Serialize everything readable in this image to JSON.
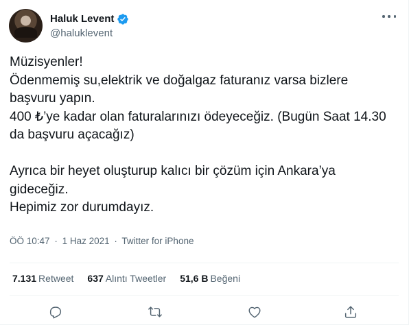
{
  "author": {
    "name": "Haluk Levent",
    "handle": "@haluklevent",
    "verified": true
  },
  "tweet": {
    "text": "Müzisyenler!\nÖdenmemiş su,elektrik ve doğalgaz faturanız varsa bizlere başvuru yapın.\n400 ₺’ye kadar olan faturalarınızı ödeyeceğiz. (Bugün Saat 14.30 da başvuru açacağız)\n\nAyrıca bir heyet oluşturup kalıcı bir çözüm için Ankara’ya gideceğiz.\nHepimiz zor durumdayız."
  },
  "meta": {
    "time": "ÖÖ 10:47",
    "date": "1 Haz 2021",
    "source": "Twitter for iPhone",
    "separator": "·"
  },
  "stats": {
    "retweets_count": "7.131",
    "retweets_label": "Retweet",
    "quotes_count": "637",
    "quotes_label": "Alıntı Tweetler",
    "likes_count": "51,6 B",
    "likes_label": "Beğeni"
  },
  "icons": {
    "verified": "verified-badge-icon",
    "more": "more-icon",
    "reply": "reply-icon",
    "retweet": "retweet-icon",
    "like": "like-icon",
    "share": "share-icon"
  },
  "colors": {
    "verified": "#1d9bf0",
    "text": "#0f1419",
    "secondary": "#536471",
    "border": "#eff3f4"
  }
}
